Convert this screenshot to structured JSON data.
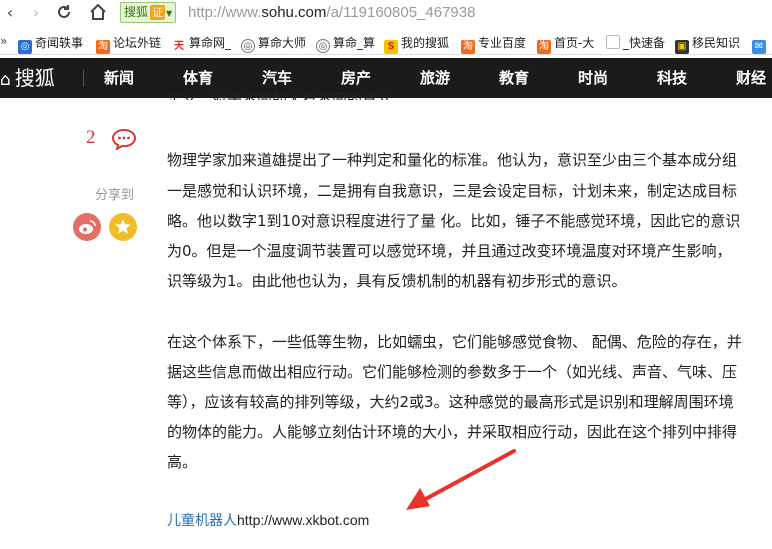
{
  "browser": {
    "security_badge": "搜狐",
    "security_badge_tag": "证",
    "url_prefix": "http://www.",
    "url_domain": "sohu.com",
    "url_path": "/a/119160805_467938"
  },
  "bookmarks": [
    {
      "label": "奇闻轶事",
      "icon": "swirl-icon",
      "color": "#2b6fd6"
    },
    {
      "label": "论坛外链",
      "icon": "taobao-icon",
      "color": "#f26b1d"
    },
    {
      "label": "算命网_",
      "icon": "fortune-icon",
      "color": "#e22"
    },
    {
      "label": "算命大师",
      "icon": "swirl-icon",
      "color": "#555"
    },
    {
      "label": "算命_算",
      "icon": "swirl-icon",
      "color": "#555"
    },
    {
      "label": "我的搜狐",
      "icon": "sohu-icon",
      "color": "#f5c400"
    },
    {
      "label": "专业百度",
      "icon": "taobao-icon",
      "color": "#f26b1d"
    },
    {
      "label": "首页-大",
      "icon": "taobao-icon",
      "color": "#f26b1d"
    },
    {
      "label": "_快速备",
      "icon": "page-icon",
      "color": "#bbb"
    },
    {
      "label": "移民知识",
      "icon": "book-icon",
      "color": "#333"
    }
  ],
  "sohu_nav": {
    "logo_text": "搜狐",
    "items": [
      "新闻",
      "体育",
      "汽车",
      "房产",
      "旅游",
      "教育",
      "时尚",
      "科技",
      "财经"
    ]
  },
  "left_rail": {
    "comment_count": "2",
    "share_label": "分享到"
  },
  "article": {
    "cut_line": "定义，对于不同的人有不同的意义。",
    "paragraph_1": [
      "物理学家加来道雄提出了一种判定和量化的标准。他认为，意识至少由三个基本成分组",
      "一是感觉和认识环境，二是拥有自我意识，三是会设定目标，计划未来，制定达成目标",
      "略。他以数字1到10对意识程度进行了量 化。比如，锤子不能感觉环境，因此它的意识",
      "为0。但是一个温度调节装置可以感觉环境，并且通过改变环境温度对环境产生影响，",
      "识等级为1。由此他也认为，具有反馈机制的机器有初步形式的意识。"
    ],
    "paragraph_2": [
      "在这个体系下，一些低等生物，比如蠕虫，它们能够感觉食物、 配偶、危险的存在，并",
      "据这些信息而做出相应行动。它们能够检测的参数多于一个（如光线、声音、气味、压",
      "等），应该有较高的排列等级，大约2或3。这种感觉的最高形式是识别和理解周围环境",
      "的物体的能力。人能够立刻估计环境的大小，并采取相应行动，因此在这个排列中排得",
      "高。"
    ],
    "link_keyword": "儿童机器人",
    "link_url": "http://www.xkbot.com"
  },
  "colors": {
    "nav_background": "#1b1b1b",
    "comment_red": "#d03a3a",
    "link_blue": "#2b6fb6",
    "arrow_red": "#e8322a",
    "weibo": "#e46d66",
    "favorite": "#f0bd28"
  }
}
